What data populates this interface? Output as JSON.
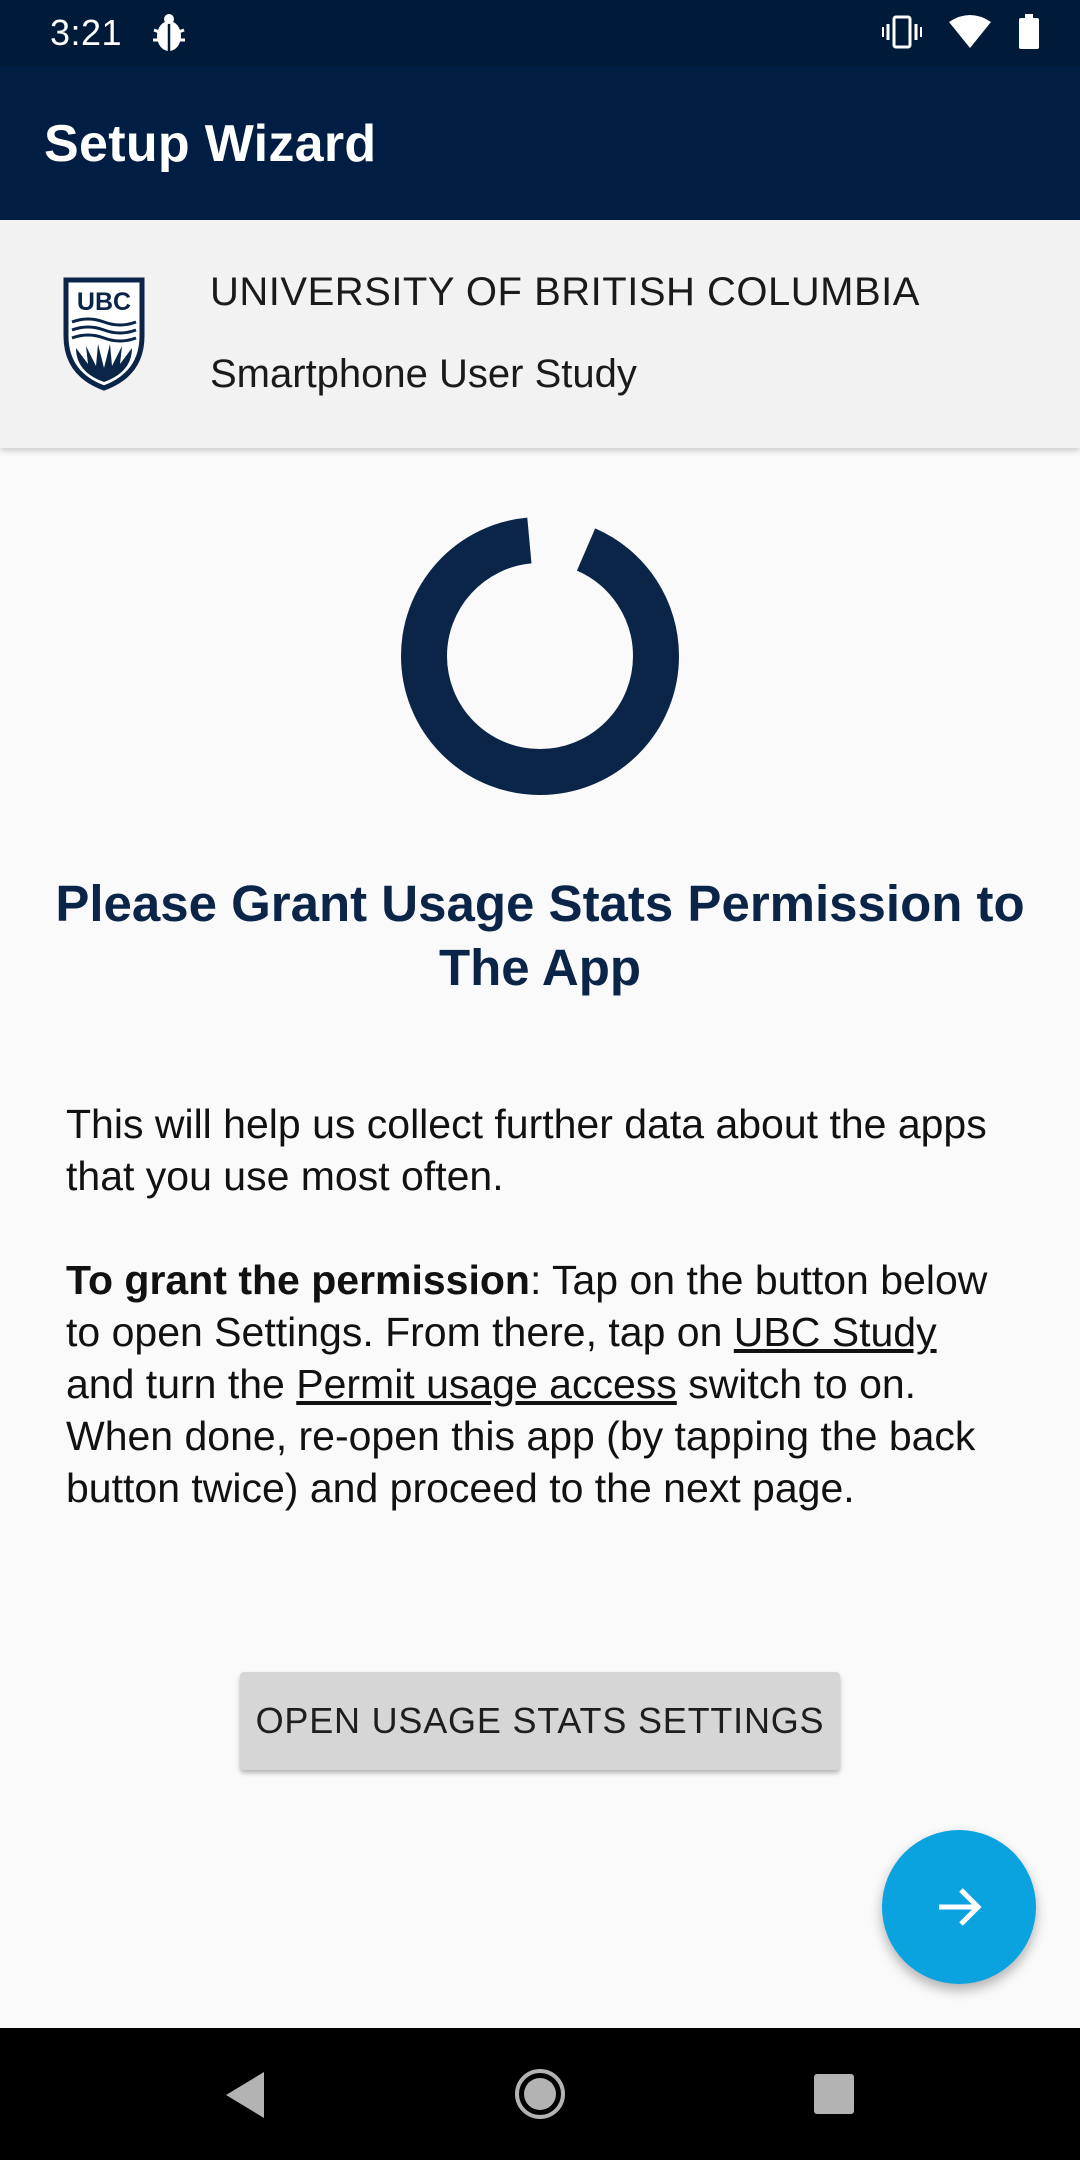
{
  "status_bar": {
    "time": "3:21",
    "icons": [
      "bug-icon",
      "vibrate-icon",
      "wifi-icon",
      "battery-icon"
    ]
  },
  "app_bar": {
    "title": "Setup Wizard"
  },
  "header": {
    "university": "UNIVERSITY OF BRITISH COLUMBIA",
    "study": "Smartphone User Study",
    "logo_text": "UBC"
  },
  "progress": {
    "value": 0.92
  },
  "content": {
    "heading": "Please Grant Usage Stats Permission to The App",
    "paragraph1": "This will help us collect further data about the apps that you use most often.",
    "paragraph2": {
      "bold": "To grant the permission",
      "text1": ": Tap on the button below to open Settings. From there, tap on ",
      "link1": "UBC Study",
      "text2": " and turn the ",
      "link2": "Permit usage access",
      "text3": " switch to on. When done, re-open this app (by tapping the back button twice) and proceed to the next page."
    },
    "button_label": "OPEN USAGE STATS SETTINGS"
  },
  "fab": {
    "icon": "arrow-right-icon"
  },
  "nav_bar": {
    "icons": [
      "back-icon",
      "home-icon",
      "recents-icon"
    ]
  },
  "colors": {
    "app_bar": "#001e44",
    "accent_navy": "#0b2548",
    "fab": "#0aa3e0"
  }
}
